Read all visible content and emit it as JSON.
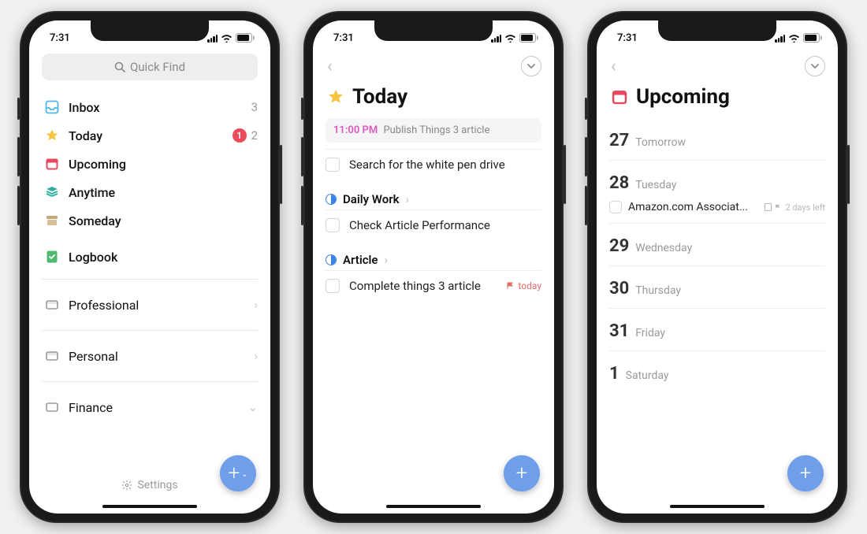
{
  "status": {
    "time": "7:31"
  },
  "screen1": {
    "search_placeholder": "Quick Find",
    "nav": [
      {
        "id": "inbox",
        "label": "Inbox",
        "count": "3"
      },
      {
        "id": "today",
        "label": "Today",
        "badge": "1",
        "count": "2"
      },
      {
        "id": "upcoming",
        "label": "Upcoming"
      },
      {
        "id": "anytime",
        "label": "Anytime"
      },
      {
        "id": "someday",
        "label": "Someday"
      },
      {
        "id": "logbook",
        "label": "Logbook"
      }
    ],
    "areas": [
      {
        "id": "professional",
        "label": "Professional",
        "trail": "chevron"
      },
      {
        "id": "personal",
        "label": "Personal",
        "trail": "chevron"
      },
      {
        "id": "finance",
        "label": "Finance",
        "trail": "caret"
      }
    ],
    "settings_label": "Settings"
  },
  "screen2": {
    "title": "Today",
    "calendar": {
      "time": "11:00 PM",
      "text": "Publish Things 3 article"
    },
    "loose_task": "Search for the white pen drive",
    "sections": [
      {
        "title": "Daily Work",
        "tasks": [
          {
            "text": "Check Article Performance"
          }
        ]
      },
      {
        "title": "Article",
        "tasks": [
          {
            "text": "Complete things 3 article",
            "flag": "today"
          }
        ]
      }
    ]
  },
  "screen3": {
    "title": "Upcoming",
    "days": [
      {
        "num": "27",
        "wd": "Tomorrow"
      },
      {
        "num": "28",
        "wd": "Tuesday",
        "tasks": [
          {
            "text": "Amazon.com Associat...",
            "meta": "2 days left"
          }
        ]
      },
      {
        "num": "29",
        "wd": "Wednesday"
      },
      {
        "num": "30",
        "wd": "Thursday"
      },
      {
        "num": "31",
        "wd": "Friday"
      },
      {
        "num": "1",
        "wd": "Saturday"
      }
    ]
  }
}
